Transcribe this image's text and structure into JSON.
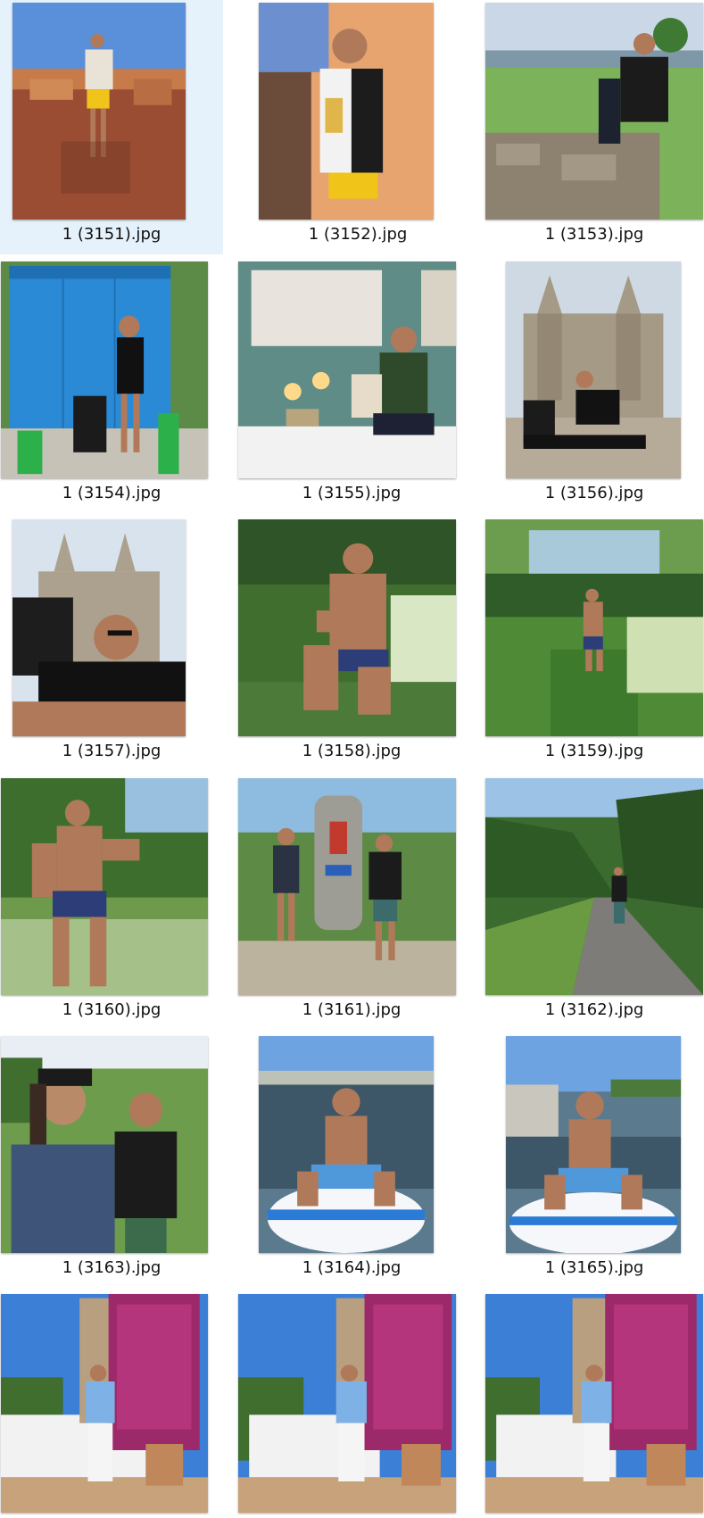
{
  "explorer": {
    "selected_file": "1 (3151).jpg",
    "files": [
      {
        "name": "1 (3151).jpg",
        "scene": "rooftop terrace, patterned shirt, yellow shorts"
      },
      {
        "name": "1 (3152).jpg",
        "scene": "rooftop terrace close-up, patterned shirt"
      },
      {
        "name": "1 (3153).jpg",
        "scene": "sitting on stone wall in green field"
      },
      {
        "name": "1 (3154).jpg",
        "scene": "standing beside blue amazon locker"
      },
      {
        "name": "1 (3155).jpg",
        "scene": "sitting at desk with lamps and pegboard"
      },
      {
        "name": "1 (3156).jpg",
        "scene": "sitting in front of cathedral"
      },
      {
        "name": "1 (3157).jpg",
        "scene": "selfie in front of cathedral with backpack"
      },
      {
        "name": "1 (3158).jpg",
        "scene": "sitting in stream among ferns"
      },
      {
        "name": "1 (3159).jpg",
        "scene": "standing in green stream, distance shot"
      },
      {
        "name": "1 (3160).jpg",
        "scene": "standing in meadow with trees"
      },
      {
        "name": "1 (3161).jpg",
        "scene": "two hikers beside stone marker"
      },
      {
        "name": "1 (3162).jpg",
        "scene": "hiker on gravel road in valley"
      },
      {
        "name": "1 (3163).jpg",
        "scene": "couple selfie on trail"
      },
      {
        "name": "1 (3164).jpg",
        "scene": "sitting on paddle board on lake"
      },
      {
        "name": "1 (3165).jpg",
        "scene": "sitting on paddle board, smiling"
      },
      {
        "name": "",
        "scene": "terrace with bougainvillea tower, striped shirt"
      },
      {
        "name": "",
        "scene": "terrace with bougainvillea tower, striped shirt"
      },
      {
        "name": "",
        "scene": "terrace with bougainvillea tower, striped shirt"
      }
    ]
  }
}
